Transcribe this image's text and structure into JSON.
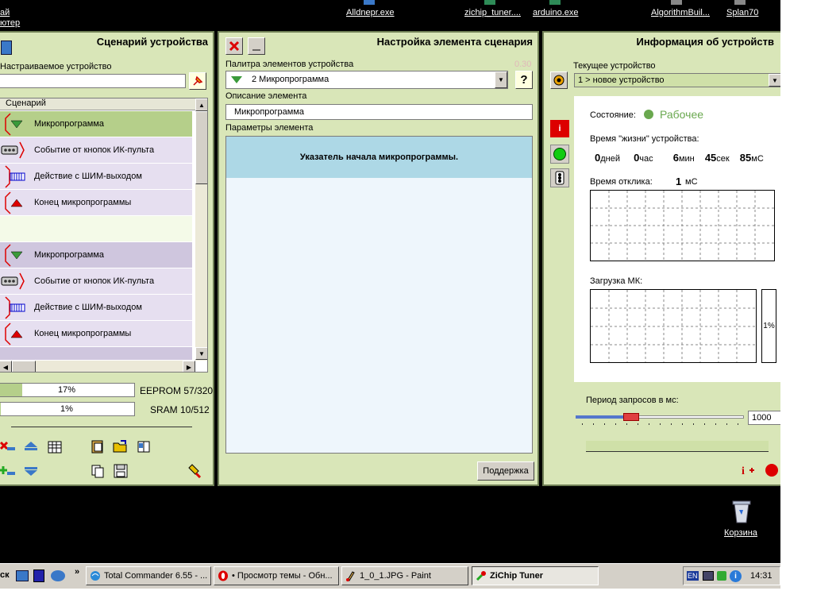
{
  "desktop": {
    "top_labels": [
      "ай",
      "ютер",
      "Alldnepr.exe",
      "zichip_tuner....",
      "arduino.exe",
      "AlgorithmBuil...",
      "Splan70"
    ],
    "recycle_label": "Корзина"
  },
  "scenario_panel": {
    "title": "Сценарий устройства",
    "device_label": "Настраиваемое устройство",
    "device_value": "",
    "list_header": "Сценарий",
    "items": [
      {
        "label": "Микропрограмма",
        "icon": "triangle-down-icon"
      },
      {
        "label": "Событие от кнопок ИК-пульта",
        "icon": "remote-control-icon"
      },
      {
        "label": "Действие с  ШИМ-выходом",
        "icon": "pwm-icon"
      },
      {
        "label": "Конец микропрограммы",
        "icon": "triangle-up-icon"
      },
      {
        "label": "",
        "icon": ""
      },
      {
        "label": "Микропрограмма",
        "icon": "triangle-down-icon"
      },
      {
        "label": "Событие от кнопок ИК-пульта",
        "icon": "remote-control-icon"
      },
      {
        "label": "Действие с  ШИМ-выходом",
        "icon": "pwm-icon"
      },
      {
        "label": "Конец микропрограммы",
        "icon": "triangle-up-icon"
      }
    ],
    "eeprom_percent_text": "17%",
    "eeprom_percent": 17,
    "eeprom_label": "EEPROM  57/320",
    "sram_percent_text": "1%",
    "sram_percent": 1,
    "sram_label": "SRAM  10/512"
  },
  "element_panel": {
    "title": "Настройка элемента сценария",
    "palette_label": "Палитра элементов устройства",
    "version": "0.30",
    "palette_value": "2  Микропрограмма",
    "help_label": "?",
    "description_label": "Описание элемента",
    "description_value": "Микропрограмма",
    "params_label": "Параметры элемента",
    "params_text": "Указатель начала микропрограммы.",
    "support_button": "Поддержка"
  },
  "info_panel": {
    "title": "Информация об устройств",
    "current_device_label": "Текущее устройство",
    "current_device_value": "1 > новое устройство",
    "state_label": "Состояние:",
    "state_value": "Рабочее",
    "life_label": "Время \"жизни\" устройства:",
    "life_days": "0",
    "life_days_unit": "дней",
    "life_hours": "0",
    "life_hours_unit": "час",
    "life_min": "6",
    "life_min_unit": "мин",
    "life_sec": "45",
    "life_sec_unit": "сек",
    "life_ms": "85",
    "life_ms_unit": "мС",
    "response_label": "Время отклика:",
    "response_value": "1",
    "response_unit": "мС",
    "load_label": "Загрузка МК:",
    "load_percent": "1%",
    "period_label": "Период запросов в мс:",
    "period_value": "1000"
  },
  "taskbar": {
    "start_fragment": "ск",
    "chevron": "»",
    "buttons": [
      {
        "label": "Total Commander 6.55 - ..."
      },
      {
        "label": "• Просмотр темы - Обн..."
      },
      {
        "label": "1_0_1.JPG - Paint"
      },
      {
        "label": "ZiChip Tuner"
      }
    ],
    "lang": "EN",
    "clock": "14:31"
  },
  "colors": {
    "panel_bg": "#d9e6b8",
    "selected_row": "#b5cf8a",
    "row_purple": "#e6dff0",
    "row_dark_purple": "#cfc6de",
    "state_green": "#6aa84f",
    "params_header": "#add8e6",
    "params_body": "#eef6fc"
  }
}
